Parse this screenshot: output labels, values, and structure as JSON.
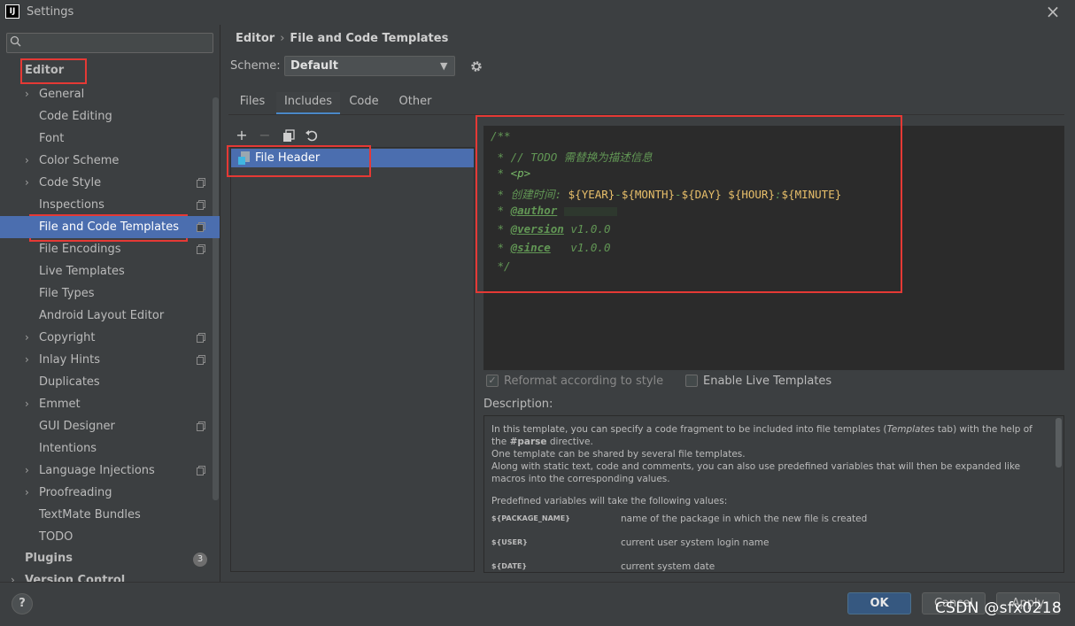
{
  "window": {
    "title": "Settings",
    "logo": "IJ",
    "close_icon": "×"
  },
  "sidebar": {
    "search_placeholder": "",
    "root": "Editor",
    "items": [
      {
        "label": "General",
        "arrow": true,
        "copy": false
      },
      {
        "label": "Code Editing",
        "arrow": false,
        "copy": false
      },
      {
        "label": "Font",
        "arrow": false,
        "copy": false
      },
      {
        "label": "Color Scheme",
        "arrow": true,
        "copy": false
      },
      {
        "label": "Code Style",
        "arrow": true,
        "copy": true
      },
      {
        "label": "Inspections",
        "arrow": false,
        "copy": true
      },
      {
        "label": "File and Code Templates",
        "arrow": false,
        "copy": true,
        "selected": true
      },
      {
        "label": "File Encodings",
        "arrow": false,
        "copy": true
      },
      {
        "label": "Live Templates",
        "arrow": false,
        "copy": false
      },
      {
        "label": "File Types",
        "arrow": false,
        "copy": false
      },
      {
        "label": "Android Layout Editor",
        "arrow": false,
        "copy": false
      },
      {
        "label": "Copyright",
        "arrow": true,
        "copy": true
      },
      {
        "label": "Inlay Hints",
        "arrow": true,
        "copy": true
      },
      {
        "label": "Duplicates",
        "arrow": false,
        "copy": false
      },
      {
        "label": "Emmet",
        "arrow": true,
        "copy": false
      },
      {
        "label": "GUI Designer",
        "arrow": false,
        "copy": true
      },
      {
        "label": "Intentions",
        "arrow": false,
        "copy": false
      },
      {
        "label": "Language Injections",
        "arrow": true,
        "copy": true
      },
      {
        "label": "Proofreading",
        "arrow": true,
        "copy": false
      },
      {
        "label": "TextMate Bundles",
        "arrow": false,
        "copy": false
      },
      {
        "label": "TODO",
        "arrow": false,
        "copy": false
      }
    ],
    "plugins": "Plugins",
    "plugins_badge": "3",
    "version_control": "Version Control"
  },
  "breadcrumb": {
    "parent": "Editor",
    "separator": "›",
    "current": "File and Code Templates"
  },
  "scheme": {
    "label": "Scheme:",
    "value": "Default"
  },
  "tabs": [
    "Files",
    "Includes",
    "Code",
    "Other"
  ],
  "template_list": {
    "items": [
      "File Header"
    ]
  },
  "code_lines": {
    "l1": "/**",
    "l2": " * // TODO 需替换为描述信息",
    "l3_pre": " * ",
    "l3_tag": "<p>",
    "l4_pre": " * 创建时间: ",
    "v_year": "${YEAR}",
    "v_month": "${MONTH}",
    "v_day": "${DAY}",
    "v_hour": "${HOUR}",
    "v_minute": "${MINUTE}",
    "dash": "-",
    "space": " ",
    "colon": ":",
    "l5_pre": " * ",
    "author": "@author",
    "l6_pre": " * ",
    "version": "@version",
    "version_val": " v1.0.0",
    "l7_pre": " * ",
    "since": "@since",
    "since_val": "   v1.0.0",
    "l8": " */"
  },
  "options": {
    "reformat": "Reformat according to style",
    "live": "Enable Live Templates"
  },
  "description": {
    "label": "Description:",
    "p1_a": "In this template, you can specify a code fragment to be included into file templates (",
    "p1_em": "Templates",
    "p1_b": " tab) with the help of the ",
    "p1_parse": "#parse",
    "p1_c": " directive.",
    "p2": "One template can be shared by several file templates.",
    "p3": "Along with static text, code and comments, you can also use predefined variables that will then be expanded like macros into the corresponding values.",
    "p4": "Predefined variables will take the following values:",
    "vars": [
      {
        "name": "${PACKAGE_NAME}",
        "desc": "name of the package in which the new file is created"
      },
      {
        "name": "${USER}",
        "desc": "current user system login name"
      },
      {
        "name": "${DATE}",
        "desc": "current system date"
      }
    ]
  },
  "buttons": {
    "ok": "OK",
    "cancel": "Cancel",
    "apply": "Apply",
    "help": "?"
  },
  "watermark": "CSDN @sfx0218"
}
